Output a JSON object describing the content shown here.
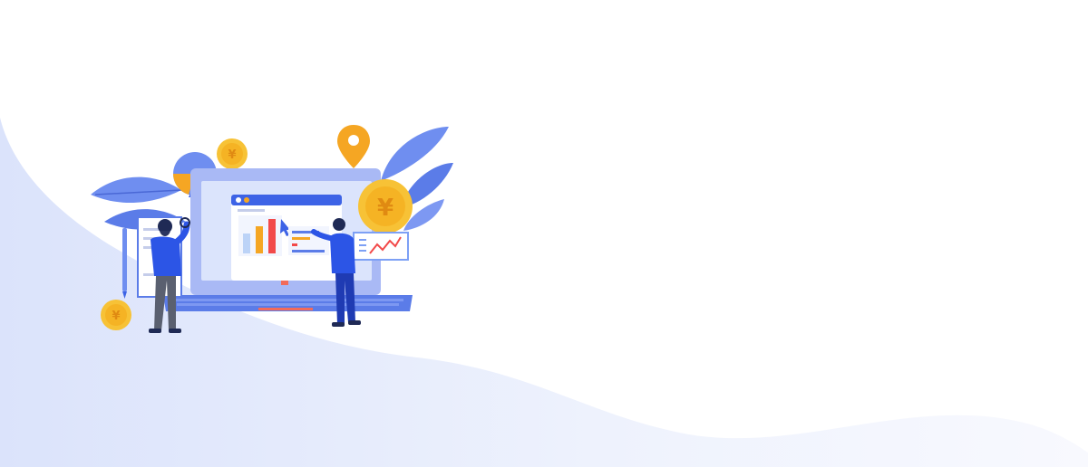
{
  "banner": {
    "currency_symbol": "¥"
  },
  "colors": {
    "wave_start": "#dde5fb",
    "wave_end": "#f6f8fe",
    "primary_blue": "#3d63e6",
    "laptop_light": "#a9b9f5",
    "leaf_blue": "#6f8ef0",
    "coin_gold": "#f7c236",
    "coin_dark": "#e99a1a",
    "pin_orange": "#f5a623",
    "bar_red": "#f24a4a",
    "bar_orange": "#f5a623",
    "bar_lightblue": "#bcd3f7"
  }
}
